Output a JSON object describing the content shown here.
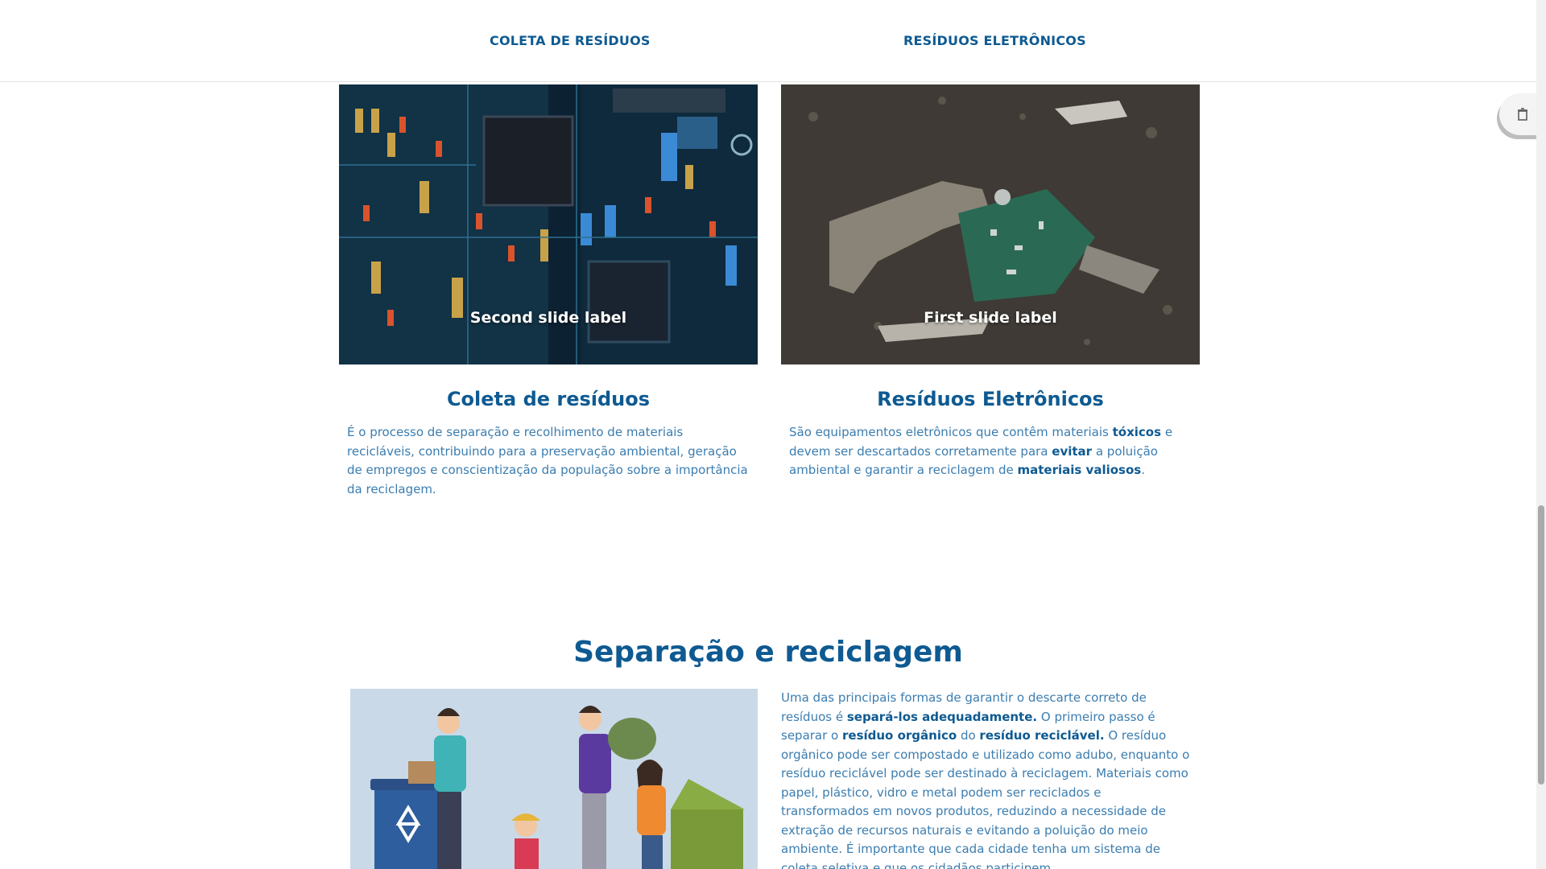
{
  "nav": {
    "link1": "COLETA DE RESÍDUOS",
    "link2": "RESÍDUOS ELETRÔNICOS"
  },
  "cards": [
    {
      "slide_label": "Second slide label",
      "title": "Coleta de resíduos",
      "text": "É o processo de separação e recolhimento de materiais recicláveis, contribuindo para a preservação ambiental, geração de empregos e conscientização da população sobre a importância da reciclagem."
    },
    {
      "slide_label": "First slide label",
      "title": "Resíduos Eletrônicos",
      "text_a": "São equipamentos eletrônicos que contêm materiais ",
      "text_b1": "tóxicos",
      "text_c": " e devem ser descartados corretamente para ",
      "text_b2": "evitar",
      "text_d": " a poluição ambiental e garantir a reciclagem de ",
      "text_b3": "materiais valiosos",
      "text_e": "."
    }
  ],
  "separacao": {
    "title": "Separação e reciclagem",
    "p1": "Uma das principais formas de garantir o descarte correto de resíduos é ",
    "b1": "separá-los adequadamente.",
    "p2": " O primeiro passo é separar o ",
    "b2": "resíduo orgânico",
    "p3": " do ",
    "b3": "resíduo reciclável.",
    "p4": " O resíduo orgânico pode ser compostado e utilizado como adubo, enquanto o resíduo reciclável pode ser destinado à reciclagem. Materiais como papel, plástico, vidro e metal podem ser reciclados e transformados em novos produtos, reduzindo a necessidade de extração de recursos naturais e evitando a poluição do meio ambiente. É importante que cada cidade tenha um sistema de coleta seletiva e que os cidadãos participem"
  },
  "colors": {
    "primary": "#0e5a92",
    "text": "#3b7db0"
  }
}
